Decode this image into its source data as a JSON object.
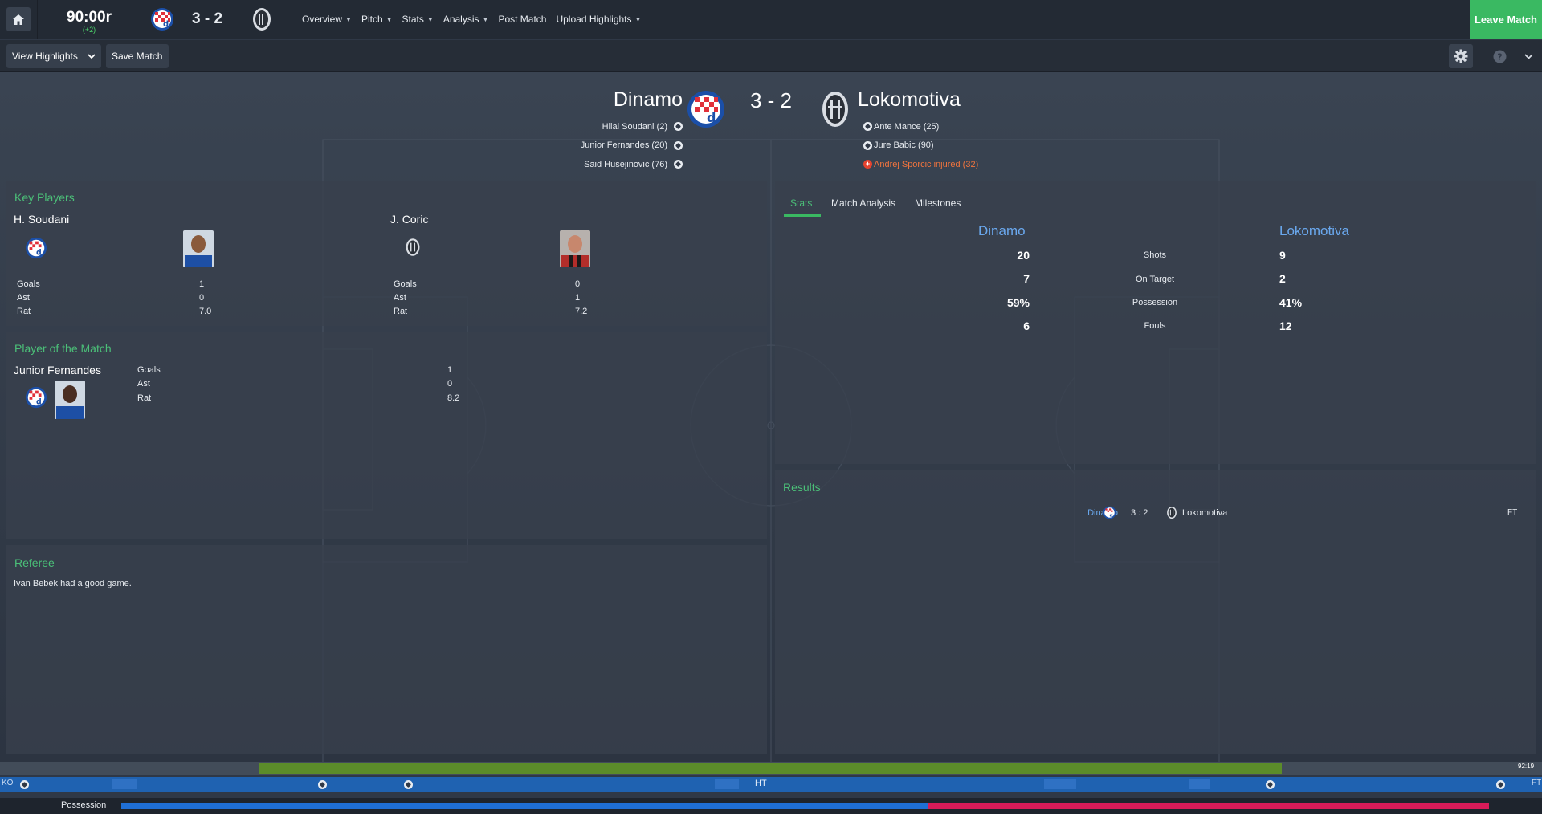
{
  "topbar": {
    "clock": "90:00r",
    "added_time": "(+2)",
    "score": "3 - 2",
    "menu": [
      {
        "label": "Overview",
        "has_dropdown": true
      },
      {
        "label": "Pitch",
        "has_dropdown": true
      },
      {
        "label": "Stats",
        "has_dropdown": true
      },
      {
        "label": "Analysis",
        "has_dropdown": true
      },
      {
        "label": "Post Match",
        "has_dropdown": false
      },
      {
        "label": "Upload Highlights",
        "has_dropdown": true
      }
    ],
    "leave_label": "Leave Match",
    "icons": [
      "home-icon",
      "dinamo-crest-icon",
      "lokomotiva-crest-icon"
    ]
  },
  "toolbar": {
    "view_highlights": "View Highlights",
    "save_match": "Save Match",
    "icons": [
      "gear-icon",
      "help-icon",
      "chevron-down-icon"
    ]
  },
  "header": {
    "home_team": "Dinamo",
    "away_team": "Lokomotiva",
    "score": "3 - 2",
    "home_scorers": [
      "Hilal Soudani (2)",
      "Junior Fernandes (20)",
      "Said Husejinovic (76)"
    ],
    "away_events": [
      "Ante Mance (25)",
      "Jure Babic (90)"
    ],
    "away_injury": "Andrej Sporcic injured (32)"
  },
  "key_players": {
    "title": "Key Players",
    "players": [
      {
        "name": "H. Soudani",
        "labels": [
          "Goals",
          "Ast",
          "Rat"
        ],
        "values": [
          "1",
          "0",
          "7.0"
        ]
      },
      {
        "name": "J. Coric",
        "labels": [
          "Goals",
          "Ast",
          "Rat"
        ],
        "values": [
          "0",
          "1",
          "7.2"
        ]
      }
    ]
  },
  "potm": {
    "title": "Player of the Match",
    "name": "Junior Fernandes",
    "labels": [
      "Goals",
      "Ast",
      "Rat"
    ],
    "values": [
      "1",
      "0",
      "8.2"
    ]
  },
  "referee": {
    "title": "Referee",
    "text": "Ivan Bebek had a good game."
  },
  "stats": {
    "tabs": [
      "Stats",
      "Match Analysis",
      "Milestones"
    ],
    "active_tab": "Stats",
    "home": "Dinamo",
    "away": "Lokomotiva",
    "rows": [
      {
        "label": "Shots",
        "home": "20",
        "away": "9"
      },
      {
        "label": "On Target",
        "home": "7",
        "away": "2"
      },
      {
        "label": "Possession",
        "home": "59%",
        "away": "41%"
      },
      {
        "label": "Fouls",
        "home": "6",
        "away": "12"
      }
    ]
  },
  "results": {
    "title": "Results",
    "home": "Dinamo",
    "score": "3 : 2",
    "away": "Lokomotiva",
    "status": "FT"
  },
  "timeline": {
    "time_badge": "92:19",
    "ko": "KO",
    "ht": "HT",
    "ft": "FT"
  },
  "possession": {
    "label": "Possession",
    "home_share": 0.59,
    "away_share": 0.41
  },
  "colors": {
    "accent_green": "#3ab962",
    "title_green": "#4bbf78",
    "team_blue": "#6aa8ee",
    "injury_orange": "#f0743e",
    "home_bar": "#1f6fd6",
    "away_bar": "#d81b59"
  }
}
